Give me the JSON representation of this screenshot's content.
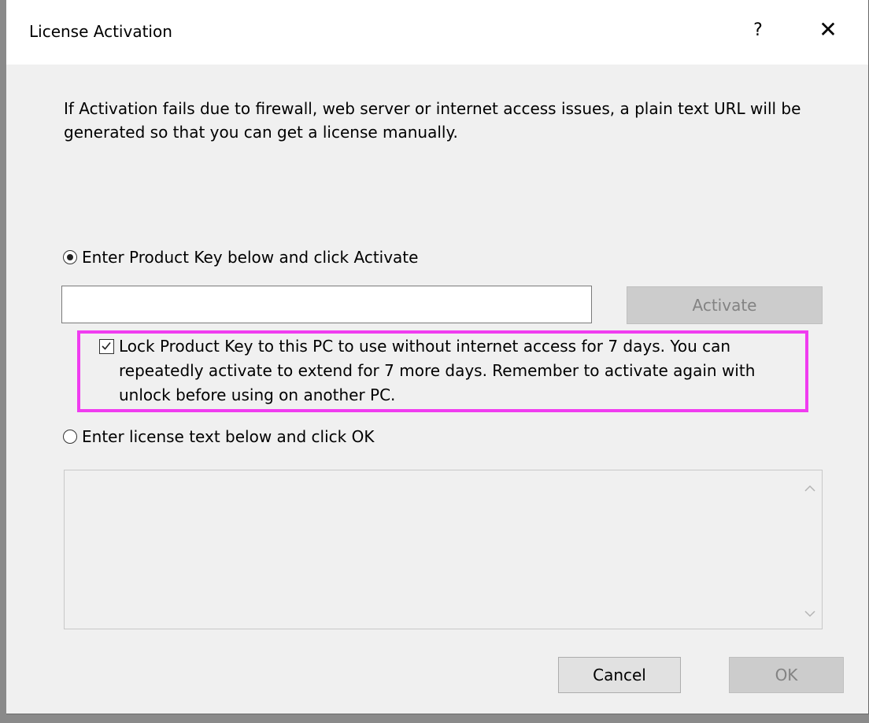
{
  "window": {
    "title": "License Activation",
    "help_label": "?",
    "close_label": "✕"
  },
  "intro_text": "If Activation fails due to firewall, web server or internet access issues, a plain text URL will be generated so that you can get a license manually.",
  "option_product_key": {
    "label": "Enter Product Key below and click Activate",
    "selected": true
  },
  "product_key_input": {
    "value": "",
    "placeholder": ""
  },
  "activate_button": {
    "label": "Activate",
    "enabled": false
  },
  "lock_option": {
    "checked": true,
    "label": "Lock Product Key to this PC to use without internet access for 7 days. You can repeatedly activate to extend for 7 more days. Remember to activate again with unlock before using on another PC."
  },
  "option_license_text": {
    "label": "Enter license text below and click OK",
    "selected": false
  },
  "license_textarea": {
    "value": ""
  },
  "footer": {
    "cancel_label": "Cancel",
    "ok_label": "OK"
  },
  "colors": {
    "highlight": "#f03cf0",
    "dialog_bg": "#f0f0f0",
    "disabled_text": "#838383"
  }
}
